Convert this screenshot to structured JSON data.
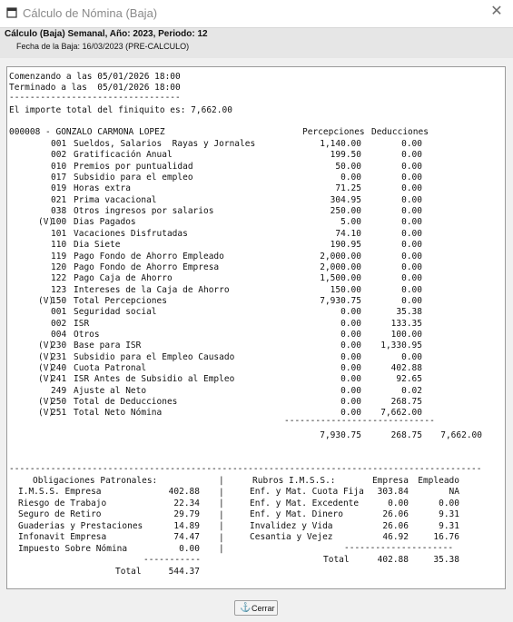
{
  "window": {
    "title": "Cálculo de Nómina (Baja)",
    "close_glyph": "✕"
  },
  "header": {
    "line1": "Cálculo (Baja) Semanal, Año: 2023, Periodo: 12",
    "line2": "Fecha de la Baja: 16/03/2023 (PRE-CALCULO)"
  },
  "report": {
    "start": "Comenzando a las 05/01/2026 18:00",
    "end": "Terminado a las  05/01/2026 18:00",
    "separator": "---------------------------------",
    "total_line": "El importe total del finiquito es: 7,662.00",
    "employee": "000008 - GONZALO CARMONA LOPEZ",
    "col_percepciones": "Percepciones",
    "col_deducciones": "Deducciones",
    "concepts": [
      {
        "flag": "",
        "code": "001",
        "name": "Sueldos, Salarios  Rayas y Jornales",
        "perc": "1,140.00",
        "ded": "0.00"
      },
      {
        "flag": "",
        "code": "002",
        "name": "Gratificación Anual",
        "perc": "199.50",
        "ded": "0.00"
      },
      {
        "flag": "",
        "code": "010",
        "name": "Premios por puntualidad",
        "perc": "50.00",
        "ded": "0.00"
      },
      {
        "flag": "",
        "code": "017",
        "name": "Subsidio para el empleo",
        "perc": "0.00",
        "ded": "0.00"
      },
      {
        "flag": "",
        "code": "019",
        "name": "Horas extra",
        "perc": "71.25",
        "ded": "0.00"
      },
      {
        "flag": "",
        "code": "021",
        "name": "Prima vacacional",
        "perc": "304.95",
        "ded": "0.00"
      },
      {
        "flag": "",
        "code": "038",
        "name": "Otros ingresos por salarios",
        "perc": "250.00",
        "ded": "0.00"
      },
      {
        "flag": "(V)",
        "code": "100",
        "name": "Dias Pagados",
        "perc": "5.00",
        "ded": "0.00"
      },
      {
        "flag": "",
        "code": "101",
        "name": "Vacaciones Disfrutadas",
        "perc": "74.10",
        "ded": "0.00"
      },
      {
        "flag": "",
        "code": "110",
        "name": "Dia Siete",
        "perc": "190.95",
        "ded": "0.00"
      },
      {
        "flag": "",
        "code": "119",
        "name": "Pago Fondo de Ahorro Empleado",
        "perc": "2,000.00",
        "ded": "0.00"
      },
      {
        "flag": "",
        "code": "120",
        "name": "Pago Fondo de Ahorro Empresa",
        "perc": "2,000.00",
        "ded": "0.00"
      },
      {
        "flag": "",
        "code": "122",
        "name": "Pago Caja de Ahorro",
        "perc": "1,500.00",
        "ded": "0.00"
      },
      {
        "flag": "",
        "code": "123",
        "name": "Intereses de la Caja de Ahorro",
        "perc": "150.00",
        "ded": "0.00"
      },
      {
        "flag": "(V)",
        "code": "150",
        "name": "Total Percepciones",
        "perc": "7,930.75",
        "ded": "0.00"
      },
      {
        "flag": "",
        "code": "001",
        "name": "Seguridad social",
        "perc": "0.00",
        "ded": "35.38"
      },
      {
        "flag": "",
        "code": "002",
        "name": "ISR",
        "perc": "0.00",
        "ded": "133.35"
      },
      {
        "flag": "",
        "code": "004",
        "name": "Otros",
        "perc": "0.00",
        "ded": "100.00"
      },
      {
        "flag": "(V)",
        "code": "230",
        "name": "Base para ISR",
        "perc": "0.00",
        "ded": "1,330.95"
      },
      {
        "flag": "(V)",
        "code": "231",
        "name": "Subsidio para el Empleo Causado",
        "perc": "0.00",
        "ded": "0.00"
      },
      {
        "flag": "(V)",
        "code": "240",
        "name": "Cuota Patronal",
        "perc": "0.00",
        "ded": "402.88"
      },
      {
        "flag": "(V)",
        "code": "241",
        "name": "ISR Antes de Subsidio al Empleo",
        "perc": "0.00",
        "ded": "92.65"
      },
      {
        "flag": "",
        "code": "249",
        "name": "Ajuste al Neto",
        "perc": "0.00",
        "ded": "0.02"
      },
      {
        "flag": "(V)",
        "code": "250",
        "name": "Total de Deducciones",
        "perc": "0.00",
        "ded": "268.75"
      },
      {
        "flag": "(V)",
        "code": "251",
        "name": "Total Neto Nómina",
        "perc": "0.00",
        "ded": "7,662.00"
      }
    ],
    "sum_rule": "-----------------------------",
    "totals": {
      "perc": "7,930.75",
      "ded": "268.75",
      "net": "7,662.00"
    },
    "long_rule": "-------------------------------------------------------------------------------------------",
    "oblig_title": "Obligaciones Patronales:",
    "obligations": [
      {
        "name": "I.M.S.S. Empresa",
        "value": "402.88"
      },
      {
        "name": "Riesgo de Trabajo",
        "value": "22.34"
      },
      {
        "name": "Seguro de Retiro",
        "value": "29.79"
      },
      {
        "name": "Guaderias y Prestaciones",
        "value": "14.89"
      },
      {
        "name": "Infonavit Empresa",
        "value": "74.47"
      },
      {
        "name": "Impuesto Sobre Nómina",
        "value": "0.00"
      }
    ],
    "oblig_rule": "-----------",
    "oblig_total_label": "Total",
    "oblig_total": "544.37",
    "divider": "|",
    "imss_title": "Rubros I.M.S.S.:",
    "col_empresa": "Empresa",
    "col_empleado": "Empleado",
    "imss": [
      {
        "name": "Enf. y Mat. Cuota Fija",
        "empresa": "303.84",
        "empleado": "NA"
      },
      {
        "name": "Enf. y Mat. Excedente",
        "empresa": "0.00",
        "empleado": "0.00"
      },
      {
        "name": "Enf. y Mat. Dinero",
        "empresa": "26.06",
        "empleado": "9.31"
      },
      {
        "name": "Invalidez y Vida",
        "empresa": "26.06",
        "empleado": "9.31"
      },
      {
        "name": "Cesantia y Vejez",
        "empresa": "46.92",
        "empleado": "16.76"
      }
    ],
    "imss_rule": "---------------------",
    "imss_total_label": "Total",
    "imss_total_empresa": "402.88",
    "imss_total_empleado": "35.38"
  },
  "buttons": {
    "close_label": "Cerrar"
  },
  "icons": {
    "app": "window-icon",
    "close": "close-icon",
    "button": "anchor-icon"
  }
}
